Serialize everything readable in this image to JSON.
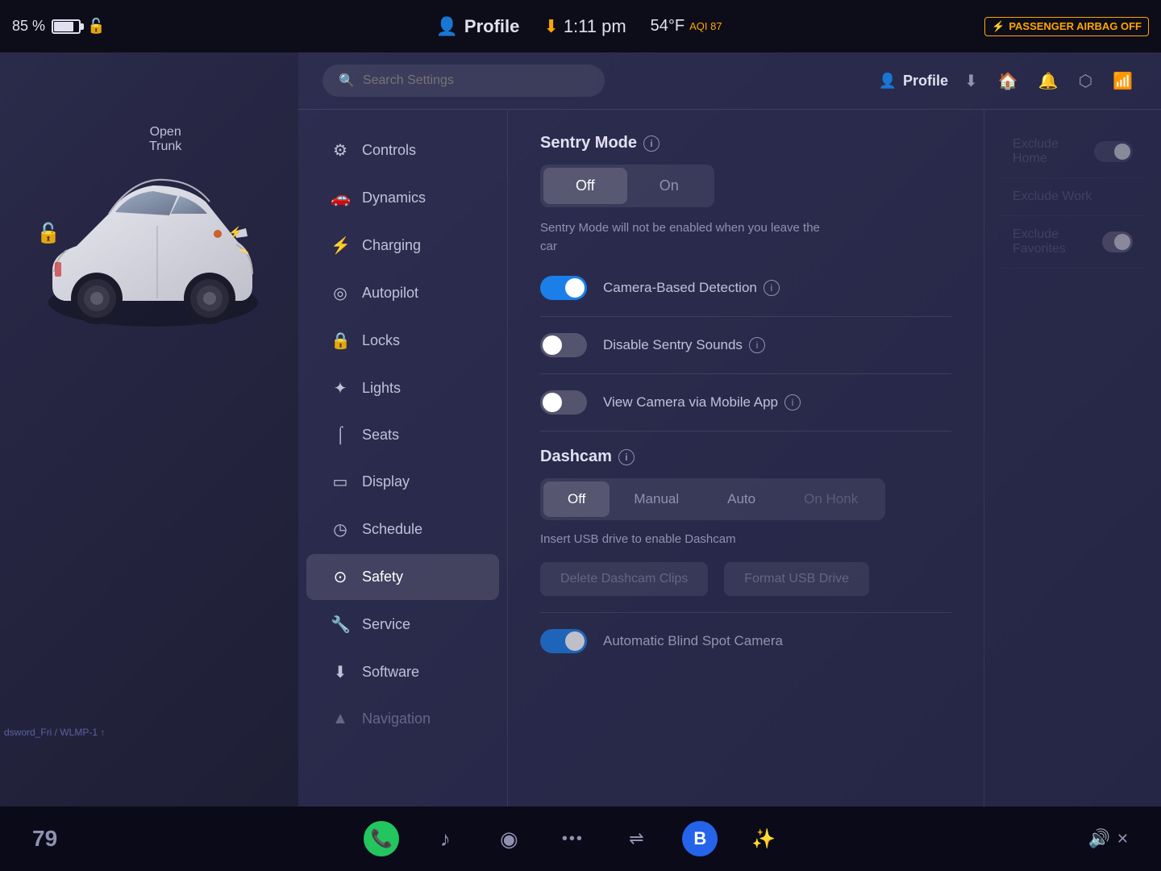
{
  "statusBar": {
    "battery": "85 %",
    "time": "1:11 pm",
    "weather": "54°F",
    "aqi": "AQI 87",
    "profile": "Profile",
    "passengerAirbag": "PASSENGER AIRBAG OFF"
  },
  "search": {
    "placeholder": "Search Settings"
  },
  "headerProfile": "Profile",
  "nav": {
    "items": [
      {
        "id": "controls",
        "label": "Controls",
        "icon": "⚙"
      },
      {
        "id": "dynamics",
        "label": "Dynamics",
        "icon": "🚗"
      },
      {
        "id": "charging",
        "label": "Charging",
        "icon": "⚡"
      },
      {
        "id": "autopilot",
        "label": "Autopilot",
        "icon": "🎯"
      },
      {
        "id": "locks",
        "label": "Locks",
        "icon": "🔒"
      },
      {
        "id": "lights",
        "label": "Lights",
        "icon": "✨"
      },
      {
        "id": "seats",
        "label": "Seats",
        "icon": "💺"
      },
      {
        "id": "display",
        "label": "Display",
        "icon": "🖥"
      },
      {
        "id": "schedule",
        "label": "Schedule",
        "icon": "🕐"
      },
      {
        "id": "safety",
        "label": "Safety",
        "icon": "⚠"
      },
      {
        "id": "service",
        "label": "Service",
        "icon": "🔧"
      },
      {
        "id": "software",
        "label": "Software",
        "icon": "⬇"
      },
      {
        "id": "navigation",
        "label": "Navigation",
        "icon": "🗺"
      }
    ]
  },
  "sentryMode": {
    "title": "Sentry Mode",
    "offLabel": "Off",
    "onLabel": "On",
    "currentState": "off",
    "description": "Sentry Mode will not be enabled when you leave the car"
  },
  "cameraDetection": {
    "label": "Camera-Based Detection",
    "state": "on"
  },
  "disableSentrySounds": {
    "label": "Disable Sentry Sounds",
    "state": "off"
  },
  "viewCamera": {
    "label": "View Camera via Mobile App",
    "state": "off"
  },
  "excludeOptions": {
    "home": "Exclude Home",
    "work": "Exclude Work",
    "favorites": "Exclude Favorites"
  },
  "dashcam": {
    "title": "Dashcam",
    "offLabel": "Off",
    "manualLabel": "Manual",
    "autoLabel": "Auto",
    "onHonkLabel": "On Honk",
    "currentState": "off",
    "usbMessage": "Insert USB drive to enable Dashcam",
    "deleteClips": "Delete Dashcam Clips",
    "formatUSB": "Format USB Drive"
  },
  "blindSpot": {
    "label": "Automatic Blind Spot Camera",
    "state": "on"
  },
  "carInfo": {
    "openLabel": "Open",
    "trunkLabel": "Trunk"
  },
  "taskbar": {
    "number": "79",
    "volumeLabel": "Volume",
    "wifiStatus": "dsword_Fri / WLMP-1  ↑"
  }
}
